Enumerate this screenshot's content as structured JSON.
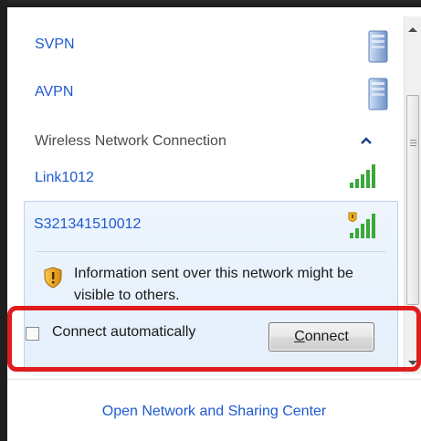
{
  "vpn_connections": [
    {
      "label": "SVPN",
      "icon": "vpn-server-icon"
    },
    {
      "label": "AVPN",
      "icon": "vpn-server-icon"
    }
  ],
  "wireless_section": {
    "header": "Wireless Network Connection",
    "collapse_icon": "chevron-up-icon"
  },
  "networks": [
    {
      "ssid": "Link1012",
      "signal_icon": "signal-strength-icon",
      "secured": true
    },
    {
      "ssid": "S321341510012",
      "signal_icon": "unsecured-signal-icon",
      "secured": false
    }
  ],
  "selected_network": {
    "ssid": "S321341510012",
    "warning_icon": "warning-shield-icon",
    "info_text": "Information sent over this network might be visible to others.",
    "auto_connect_label": "Connect automatically",
    "auto_connect_checked": false,
    "connect_button": {
      "mnemonic": "C",
      "rest": "onnect"
    }
  },
  "footer": {
    "link": "Open Network and Sharing Center"
  },
  "colors": {
    "link_blue": "#1e5ad0",
    "highlight_red": "#e01c1c",
    "selection_bg": "#e4effb",
    "selection_border": "#b9d3ef"
  }
}
